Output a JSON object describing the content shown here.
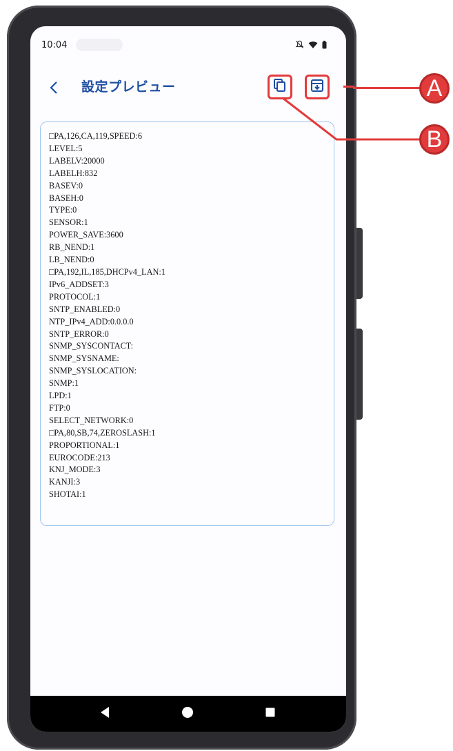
{
  "status_bar": {
    "time": "10:04",
    "icons": [
      "bell-off-icon",
      "wifi-icon",
      "battery-icon"
    ]
  },
  "app_bar": {
    "back_icon": "chevron-left-icon",
    "title": "設定プレビュー",
    "copy_icon": "copy-icon",
    "save_icon": "download-box-icon"
  },
  "preview": {
    "lines": [
      "□PA,126,CA,119,SPEED:6",
      "LEVEL:5",
      "LABELV:20000",
      "LABELH:832",
      "BASEV:0",
      "BASEH:0",
      "TYPE:0",
      "SENSOR:1",
      "POWER_SAVE:3600",
      "RB_NEND:1",
      "LB_NEND:0",
      "□PA,192,IL,185,DHCPv4_LAN:1",
      "IPv6_ADDSET:3",
      "PROTOCOL:1",
      "SNTP_ENABLED:0",
      "NTP_IPv4_ADD:0.0.0.0",
      "SNTP_ERROR:0",
      "SNMP_SYSCONTACT:",
      "SNMP_SYSNAME:",
      "SNMP_SYSLOCATION:",
      "SNMP:1",
      "LPD:1",
      "FTP:0",
      "SELECT_NETWORK:0",
      "□PA,80,SB,74,ZEROSLASH:1",
      "PROPORTIONAL:1",
      "EUROCODE:213",
      "KNJ_MODE:3",
      "KANJI:3",
      "SHOTAI:1"
    ]
  },
  "nav_bar": {
    "icons": [
      "back-triangle-icon",
      "home-circle-icon",
      "recents-square-icon"
    ]
  },
  "callouts": {
    "a": "A",
    "b": "B",
    "color": "#e23b3b"
  },
  "colors": {
    "title": "#1e4fa3",
    "accent_border": "#9ec6ee",
    "highlight": "#e23b3b"
  }
}
